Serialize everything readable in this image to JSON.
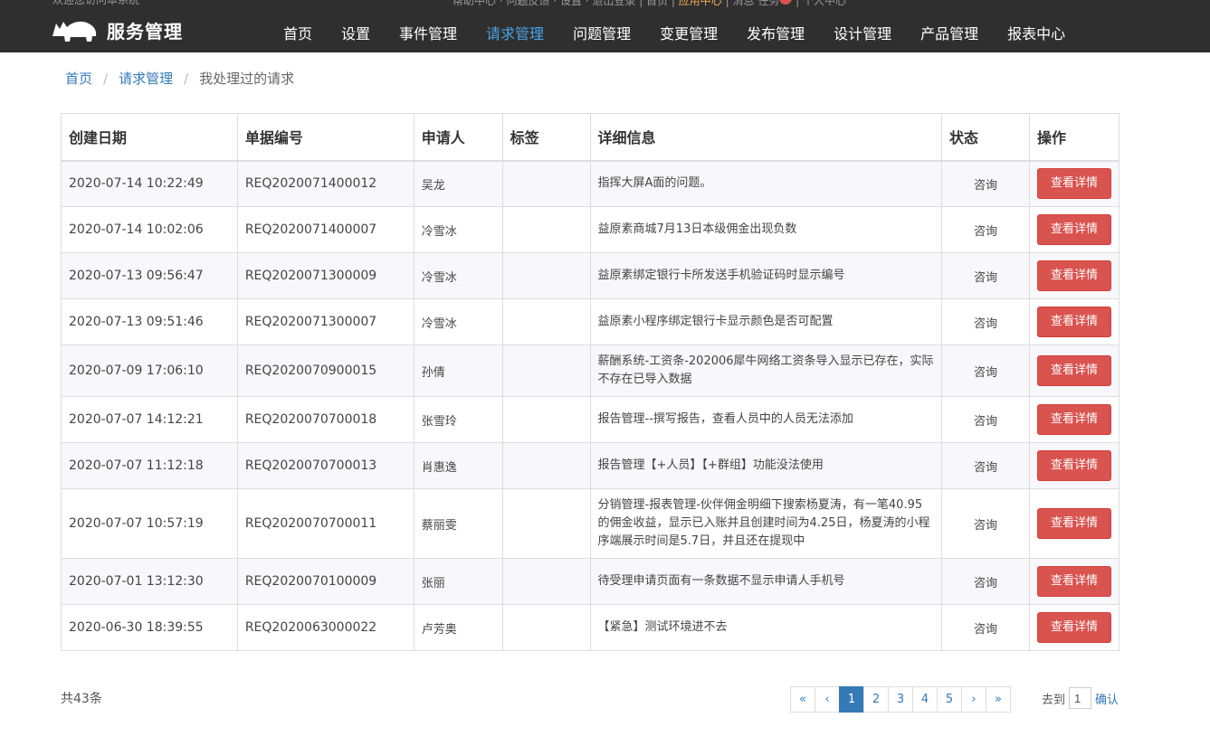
{
  "header": {
    "top_left_text": "欢迎您访问本系统",
    "top_right_items": [
      "帮助中心",
      "问题反馈",
      "设置",
      "退出登录",
      "首页",
      "应用中心",
      "消息",
      "任务",
      "个人中心"
    ],
    "brand_name": "服务管理",
    "nav": [
      "首页",
      "设置",
      "事件管理",
      "请求管理",
      "问题管理",
      "变更管理",
      "发布管理",
      "设计管理",
      "产品管理",
      "报表中心"
    ],
    "active_nav": "请求管理",
    "accent_color": "#4aa3e8"
  },
  "breadcrumb": {
    "home": "首页",
    "section": "请求管理",
    "current": "我处理过的请求"
  },
  "table": {
    "columns": [
      "创建日期",
      "单据编号",
      "申请人",
      "标签",
      "详细信息",
      "状态",
      "操作"
    ],
    "action_label": "查看详情",
    "rows": [
      {
        "date": "2020-07-14 10:22:49",
        "id": "REQ2020071400012",
        "applicant": "吴龙",
        "tag": "",
        "detail": "指挥大屏A面的问题。",
        "status": "咨询"
      },
      {
        "date": "2020-07-14 10:02:06",
        "id": "REQ2020071400007",
        "applicant": "冷雪冰",
        "tag": "",
        "detail": "益原素商城7月13日本级佣金出现负数",
        "status": "咨询"
      },
      {
        "date": "2020-07-13 09:56:47",
        "id": "REQ2020071300009",
        "applicant": "冷雪冰",
        "tag": "",
        "detail": "益原素绑定银行卡所发送手机验证码时显示编号",
        "status": "咨询"
      },
      {
        "date": "2020-07-13 09:51:46",
        "id": "REQ2020071300007",
        "applicant": "冷雪冰",
        "tag": "",
        "detail": "益原素小程序绑定银行卡显示颜色是否可配置",
        "status": "咨询"
      },
      {
        "date": "2020-07-09 17:06:10",
        "id": "REQ2020070900015",
        "applicant": "孙倩",
        "tag": "",
        "detail": "薪酬系统-工资条-202006犀牛网络工资条导入显示已存在，实际不存在已导入数据",
        "status": "咨询"
      },
      {
        "date": "2020-07-07 14:12:21",
        "id": "REQ2020070700018",
        "applicant": "张雪玲",
        "tag": "",
        "detail": "报告管理--撰写报告，查看人员中的人员无法添加",
        "status": "咨询"
      },
      {
        "date": "2020-07-07 11:12:18",
        "id": "REQ2020070700013",
        "applicant": "肖惠逸",
        "tag": "",
        "detail": "报告管理【+人员】【+群组】功能没法使用",
        "status": "咨询"
      },
      {
        "date": "2020-07-07 10:57:19",
        "id": "REQ2020070700011",
        "applicant": "蔡丽雯",
        "tag": "",
        "detail": "分销管理-报表管理-伙伴佣金明细下搜索杨夏涛，有一笔40.95的佣金收益，显示已入账并且创建时间为4.25日，杨夏涛的小程序端展示时间是5.7日，并且还在提现中",
        "status": "咨询"
      },
      {
        "date": "2020-07-01 13:12:30",
        "id": "REQ2020070100009",
        "applicant": "张丽",
        "tag": "",
        "detail": "待受理申请页面有一条数据不显示申请人手机号",
        "status": "咨询"
      },
      {
        "date": "2020-06-30 18:39:55",
        "id": "REQ2020063000022",
        "applicant": "卢芳奥",
        "tag": "",
        "detail": "【紧急】测试环境进不去",
        "status": "咨询"
      }
    ]
  },
  "footer": {
    "total": "共43条",
    "pager": [
      "«",
      "‹",
      "1",
      "2",
      "3",
      "4",
      "5",
      "›",
      "»"
    ],
    "current_page": "1",
    "goto_label": "去到",
    "goto_value": "1",
    "confirm_label": "确认"
  }
}
